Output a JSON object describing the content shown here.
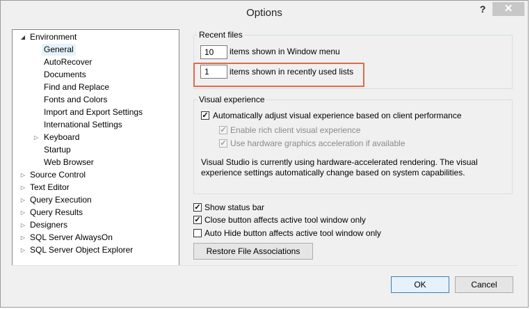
{
  "window": {
    "title": "Options",
    "help": "?",
    "close": "✕"
  },
  "tree": {
    "items": [
      {
        "label": "Environment",
        "expander": "◢"
      },
      {
        "label": "General"
      },
      {
        "label": "AutoRecover"
      },
      {
        "label": "Documents"
      },
      {
        "label": "Find and Replace"
      },
      {
        "label": "Fonts and Colors"
      },
      {
        "label": "Import and Export Settings"
      },
      {
        "label": "International Settings"
      },
      {
        "label": "Keyboard",
        "expander": "▷"
      },
      {
        "label": "Startup"
      },
      {
        "label": "Web Browser"
      },
      {
        "label": "Source Control",
        "expander": "▷"
      },
      {
        "label": "Text Editor",
        "expander": "▷"
      },
      {
        "label": "Query Execution",
        "expander": "▷"
      },
      {
        "label": "Query Results",
        "expander": "▷"
      },
      {
        "label": "Designers",
        "expander": "▷"
      },
      {
        "label": "SQL Server AlwaysOn",
        "expander": "▷"
      },
      {
        "label": "SQL Server Object Explorer",
        "expander": "▷"
      }
    ]
  },
  "recent_files": {
    "title": "Recent files",
    "window_menu_value": "10",
    "window_menu_label": "items shown in Window menu",
    "recent_lists_value": "1",
    "recent_lists_label": "items shown in recently used lists"
  },
  "visual_experience": {
    "title": "Visual experience",
    "auto_adjust_label": "Automatically adjust visual experience based on client performance",
    "auto_adjust_checked": true,
    "rich_client_label": "Enable rich client visual experience",
    "rich_client_checked": true,
    "hw_accel_label": "Use hardware graphics acceleration if available",
    "hw_accel_checked": true,
    "info_line1": "Visual Studio is currently using hardware-accelerated rendering. The visual",
    "info_line2": "experience settings automatically change based on system capabilities."
  },
  "options": {
    "show_status_bar_label": "Show status bar",
    "show_status_bar_checked": true,
    "close_button_label": "Close button affects active tool window only",
    "close_button_checked": true,
    "auto_hide_label": "Auto Hide button affects active tool window only",
    "auto_hide_checked": false,
    "restore_button": "Restore File Associations"
  },
  "buttons": {
    "ok": "OK",
    "cancel": "Cancel"
  },
  "check_glyph": "✓"
}
